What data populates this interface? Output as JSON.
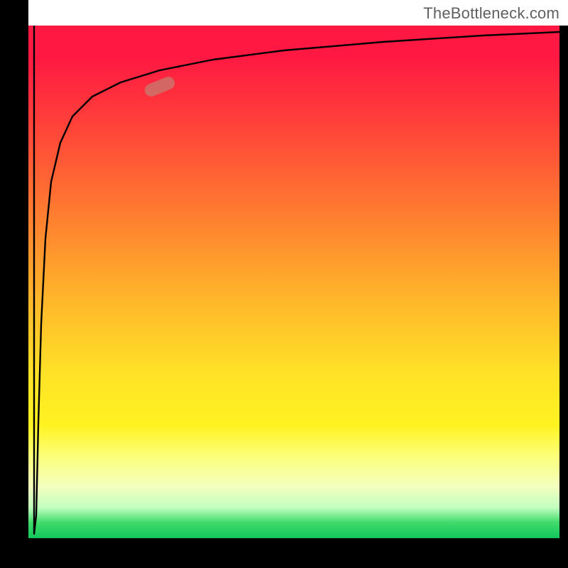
{
  "watermark": "TheBottleneck.com",
  "chart_data": {
    "type": "line",
    "title": "",
    "xlabel": "",
    "ylabel": "",
    "xlim": [
      0,
      100
    ],
    "ylim": [
      0,
      100
    ],
    "background_gradient": {
      "orientation": "vertical",
      "stops": [
        {
          "pos": 0.0,
          "color": "#ff1842"
        },
        {
          "pos": 0.18,
          "color": "#ff3d3a"
        },
        {
          "pos": 0.36,
          "color": "#ff7a30"
        },
        {
          "pos": 0.54,
          "color": "#ffb82a"
        },
        {
          "pos": 0.72,
          "color": "#ffe227"
        },
        {
          "pos": 0.84,
          "color": "#fcff7a"
        },
        {
          "pos": 0.92,
          "color": "#f3ffbe"
        },
        {
          "pos": 0.96,
          "color": "#3fd96a"
        },
        {
          "pos": 1.0,
          "color": "#13c75b"
        }
      ]
    },
    "series": [
      {
        "name": "bottleneck-curve",
        "color": "#000000",
        "x": [
          0.5,
          1,
          1.5,
          2,
          3,
          4,
          6,
          8,
          12,
          18,
          25,
          35,
          50,
          70,
          100
        ],
        "y": [
          100,
          0,
          20,
          45,
          65,
          74,
          82,
          86,
          89,
          91,
          93,
          94.5,
          96,
          97.3,
          98.5
        ],
        "note": "Curve starts with a sharp downward spike near x≈1 reaching y≈0, then rises steeply and asymptotically approaches ~98–99 as x→100."
      }
    ],
    "marker": {
      "approx_x": 25,
      "approx_y": 89,
      "shape": "rounded-pill",
      "color": "#c5786e",
      "rotation_deg": -22
    },
    "grid": false,
    "legend": false
  }
}
